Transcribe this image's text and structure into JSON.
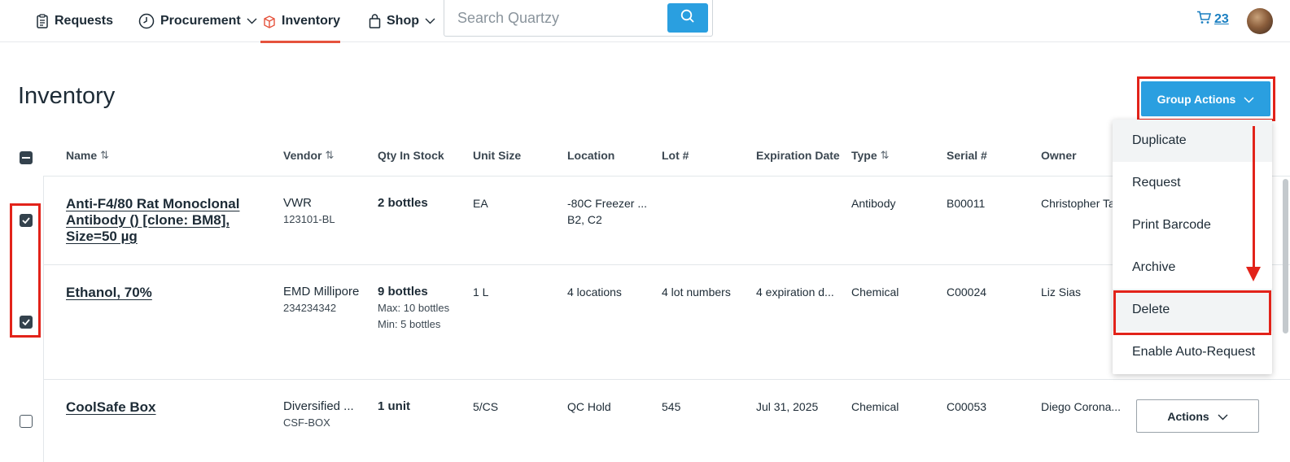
{
  "nav": {
    "requests": "Requests",
    "procurement": "Procurement",
    "inventory": "Inventory",
    "shop": "Shop",
    "search_placeholder": "Search Quartzy",
    "cart_count": "23"
  },
  "page": {
    "title": "Inventory"
  },
  "group_actions": {
    "label": "Group Actions",
    "menu": [
      "Duplicate",
      "Request",
      "Print Barcode",
      "Archive",
      "Delete",
      "Enable Auto-Request"
    ]
  },
  "table": {
    "headers": {
      "name": "Name",
      "vendor": "Vendor",
      "qty": "Qty In Stock",
      "unit": "Unit Size",
      "location": "Location",
      "lot": "Lot #",
      "expiration": "Expiration Date",
      "type": "Type",
      "serial": "Serial #",
      "owner": "Owner"
    },
    "rows": [
      {
        "checked": true,
        "name_lines": [
          "Anti-F4/80 Rat Monoclonal",
          "Antibody () [clone: BM8],",
          "Size=50 µg"
        ],
        "vendor": "VWR",
        "vendor_sub": "123101-BL",
        "qty": "2 bottles",
        "qty_max": "",
        "qty_min": "",
        "unit": "EA",
        "location": "-80C Freezer ...",
        "location_sub": "B2, C2",
        "lot": "",
        "expiration": "",
        "type": "Antibody",
        "serial": "B00011",
        "owner": "Christopher Ta"
      },
      {
        "checked": true,
        "name_lines": [
          "Ethanol, 70%"
        ],
        "vendor": "EMD Millipore",
        "vendor_sub": "234234342",
        "qty": "9 bottles",
        "qty_max": "Max: 10 bottles",
        "qty_min": "Min: 5 bottles",
        "unit": "1 L",
        "location": "4 locations",
        "location_sub": "",
        "lot": "4 lot numbers",
        "expiration": "4 expiration d...",
        "type": "Chemical",
        "serial": "C00024",
        "owner": "Liz Sias"
      },
      {
        "checked": false,
        "name_lines": [
          "CoolSafe Box"
        ],
        "vendor": "Diversified ...",
        "vendor_sub": "CSF-BOX",
        "qty": "1 unit",
        "qty_max": "",
        "qty_min": "",
        "unit": "5/CS",
        "location": "QC Hold",
        "location_sub": "",
        "lot": "545",
        "expiration": "Jul 31, 2025",
        "type": "Chemical",
        "serial": "C00053",
        "owner": "Diego Corona...",
        "actions_label": "Actions"
      }
    ]
  },
  "colors": {
    "primary": "#2a9fe0",
    "highlight": "#e2231a",
    "nav_active": "#e5533d",
    "cart": "#1a7fc1"
  }
}
